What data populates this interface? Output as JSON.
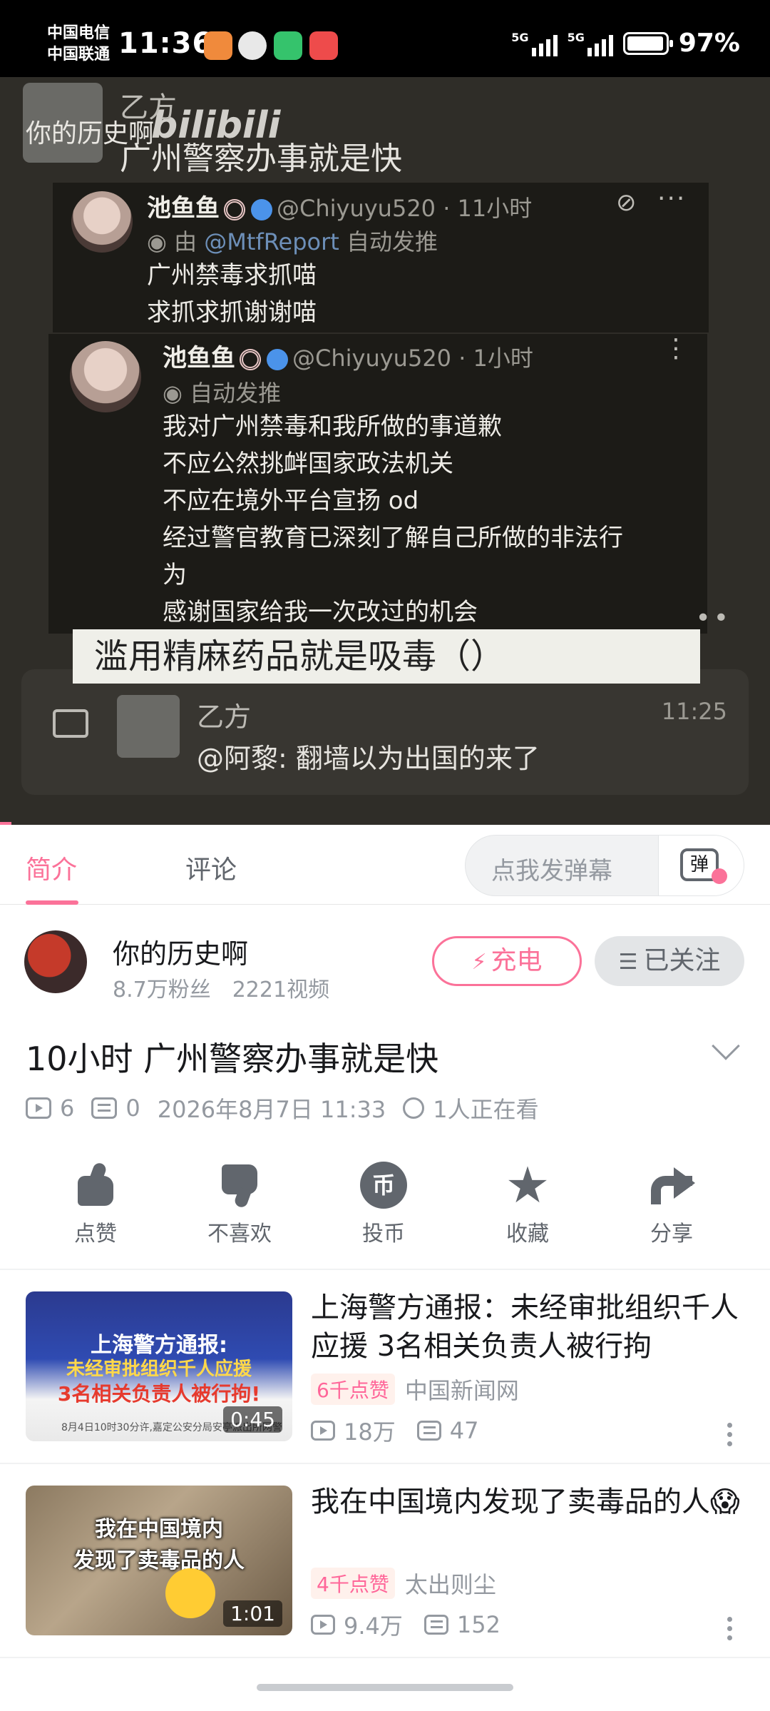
{
  "status_bar": {
    "carrier1": "中国电信",
    "carrier2": "中国联通",
    "time": "11:36",
    "signal1": "5G",
    "signal2": "5G",
    "battery": "97%"
  },
  "video": {
    "poster_name": "乙方",
    "poster_title": "广州警察办事就是快",
    "uploader_overlay": "你的历史啊",
    "watermark": "bilibili",
    "tweet1": {
      "name": "池鱼鱼",
      "handle": "@Chiyuyu520 · 11小时",
      "repost_prefix": "由",
      "repost_link": "@MtfReport",
      "repost_suffix": "自动发推",
      "lines": [
        "广州禁毒求抓喵",
        "求抓求抓谢谢喵"
      ]
    },
    "tweet2": {
      "name": "池鱼鱼",
      "handle": "@Chiyuyu520 · 1小时",
      "auto_label": "自动发推",
      "lines": [
        "我对广州禁毒和我所做的事道歉",
        "不应公然挑衅国家政法机关",
        "不应在境外平台宣扬 od",
        "经过警官教育已深刻了解自己所做的非法行",
        "为",
        "感谢国家给我一次改过的机会"
      ]
    },
    "caption": "滥用精麻药品就是吸毒（）",
    "reply": {
      "name": "乙方",
      "text": "@阿黎: 翻墙以为出国的来了",
      "time": "11:25"
    }
  },
  "tabs": {
    "intro": "简介",
    "comments": "评论",
    "danmaku_placeholder": "点我发弹幕",
    "danmaku_icon_text": "弹"
  },
  "uploader": {
    "name": "你的历史啊",
    "fans": "8.7万粉丝",
    "videos": "2221视频",
    "charge": "充电",
    "follow": "已关注"
  },
  "video_info": {
    "title": "10小时 广州警察办事就是快",
    "plays": "6",
    "danmaku": "0",
    "date": "2026年8月7日 11:33",
    "watching": "1人正在看"
  },
  "actions": {
    "like": "点赞",
    "dislike": "不喜欢",
    "coin": "投币",
    "favorite": "收藏",
    "share": "分享",
    "coin_glyph": "币"
  },
  "recommendations": [
    {
      "title": "上海警方通报：未经审批组织千人应援 3名相关负责人被行拘",
      "likes": "6千点赞",
      "channel": "中国新闻网",
      "plays": "18万",
      "danmaku": "47",
      "duration": "0:45",
      "thumb_line1": "上海警方通报:",
      "thumb_line2": "未经审批组织千人应援",
      "thumb_line3": "3名相关负责人被行拘!",
      "thumb_line4": "8月4日10时30分许,嘉定公安分局安亭派出所网警"
    },
    {
      "title": "我在中国境内发现了卖毒品的人😱",
      "likes": "4千点赞",
      "channel": "太出则尘",
      "plays": "9.4万",
      "danmaku": "152",
      "duration": "1:01",
      "thumb_line1": "我在中国境内",
      "thumb_line2": "发现了卖毒品的人"
    }
  ],
  "colors": {
    "accent": "#fb7299",
    "text": "#18191c",
    "secondary": "#9499a0"
  }
}
